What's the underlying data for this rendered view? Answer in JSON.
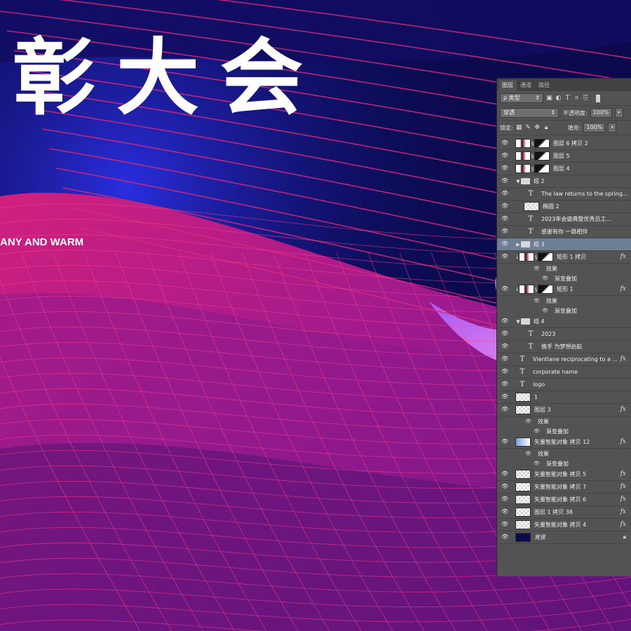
{
  "canvas": {
    "headline": "彰大会",
    "tagline": "ANY AND WARM",
    "colors": {
      "bg_dark": "#0b0a4e",
      "magenta": "#d6207a",
      "blue": "#1b1bd6",
      "violet": "#b36cf0"
    }
  },
  "panel": {
    "tabs": [
      "图层",
      "通道",
      "路径"
    ],
    "filter_kind": "ρ 类型",
    "blend_mode": "穿透",
    "opacity_label": "不透明度:",
    "opacity_value": "100%",
    "lock_label": "锁定:",
    "fill_label": "填充:",
    "fill_value": "100%",
    "icons": [
      "image-filter-icon",
      "adjustment-filter-icon",
      "type-filter-icon",
      "shape-filter-icon",
      "smart-filter-icon",
      "toggle-icon"
    ],
    "layers": [
      {
        "name": "图层 6 拷贝 2",
        "kind": "masked",
        "indent": 0
      },
      {
        "name": "图层 5",
        "kind": "masked",
        "indent": 0
      },
      {
        "name": "图层 4",
        "kind": "masked",
        "indent": 0
      },
      {
        "name": "组 2",
        "kind": "group-open",
        "indent": 0
      },
      {
        "name": "The law returns to the spring...",
        "kind": "text",
        "indent": 1
      },
      {
        "name": "椭圆 2",
        "kind": "shape",
        "indent": 1
      },
      {
        "name": "2023年会盛典暨优秀员工...",
        "kind": "text",
        "indent": 1
      },
      {
        "name": "感谢有你   一路相伴",
        "kind": "text",
        "indent": 1
      },
      {
        "name": "组 3",
        "kind": "group-closed",
        "indent": 0,
        "selected": true
      },
      {
        "name": "矩形 1 拷贝",
        "kind": "masked-clip",
        "indent": 0,
        "fx": true
      },
      {
        "name": "效果",
        "kind": "effect",
        "indent": 2
      },
      {
        "name": "渐变叠加",
        "kind": "effect-item",
        "indent": 3
      },
      {
        "name": "矩形 1",
        "kind": "masked-clip",
        "indent": 0,
        "fx": true
      },
      {
        "name": "效果",
        "kind": "effect",
        "indent": 2
      },
      {
        "name": "渐变叠加",
        "kind": "effect-item",
        "indent": 3
      },
      {
        "name": "组 4",
        "kind": "group-open",
        "indent": 0
      },
      {
        "name": "2023",
        "kind": "text",
        "indent": 1
      },
      {
        "name": "携手          为梦想启航",
        "kind": "text",
        "indent": 1
      },
      {
        "name": "Vientiane reciprocating to a ...",
        "kind": "text",
        "indent": 0,
        "fx": true
      },
      {
        "name": "corporate name",
        "kind": "text",
        "indent": 0
      },
      {
        "name": "logo",
        "kind": "text",
        "indent": 0
      },
      {
        "name": "1",
        "kind": "pixel",
        "indent": 0
      },
      {
        "name": "图层 3",
        "kind": "pixel",
        "indent": 0,
        "fx": true
      },
      {
        "name": "效果",
        "kind": "effect",
        "indent": 1
      },
      {
        "name": "渐变叠加",
        "kind": "effect-item",
        "indent": 2
      },
      {
        "name": "矢量智能对象 拷贝 12",
        "kind": "smart",
        "indent": 0,
        "fx": true
      },
      {
        "name": "效果",
        "kind": "effect",
        "indent": 1
      },
      {
        "name": "渐变叠加",
        "kind": "effect-item",
        "indent": 2
      },
      {
        "name": "矢量智能对象 拷贝 5",
        "kind": "pixel",
        "indent": 0,
        "fx": true
      },
      {
        "name": "矢量智能对象 拷贝 7",
        "kind": "pixel",
        "indent": 0,
        "fx": true
      },
      {
        "name": "矢量智能对象 拷贝 6",
        "kind": "pixel",
        "indent": 0,
        "fx": true
      },
      {
        "name": "图层 1 拷贝 38",
        "kind": "pixel",
        "indent": 0,
        "fx": true
      },
      {
        "name": "矢量智能对象 拷贝 4",
        "kind": "pixel",
        "indent": 0,
        "fx": true
      },
      {
        "name": "背景",
        "kind": "background",
        "indent": 0,
        "locked": true
      }
    ]
  }
}
